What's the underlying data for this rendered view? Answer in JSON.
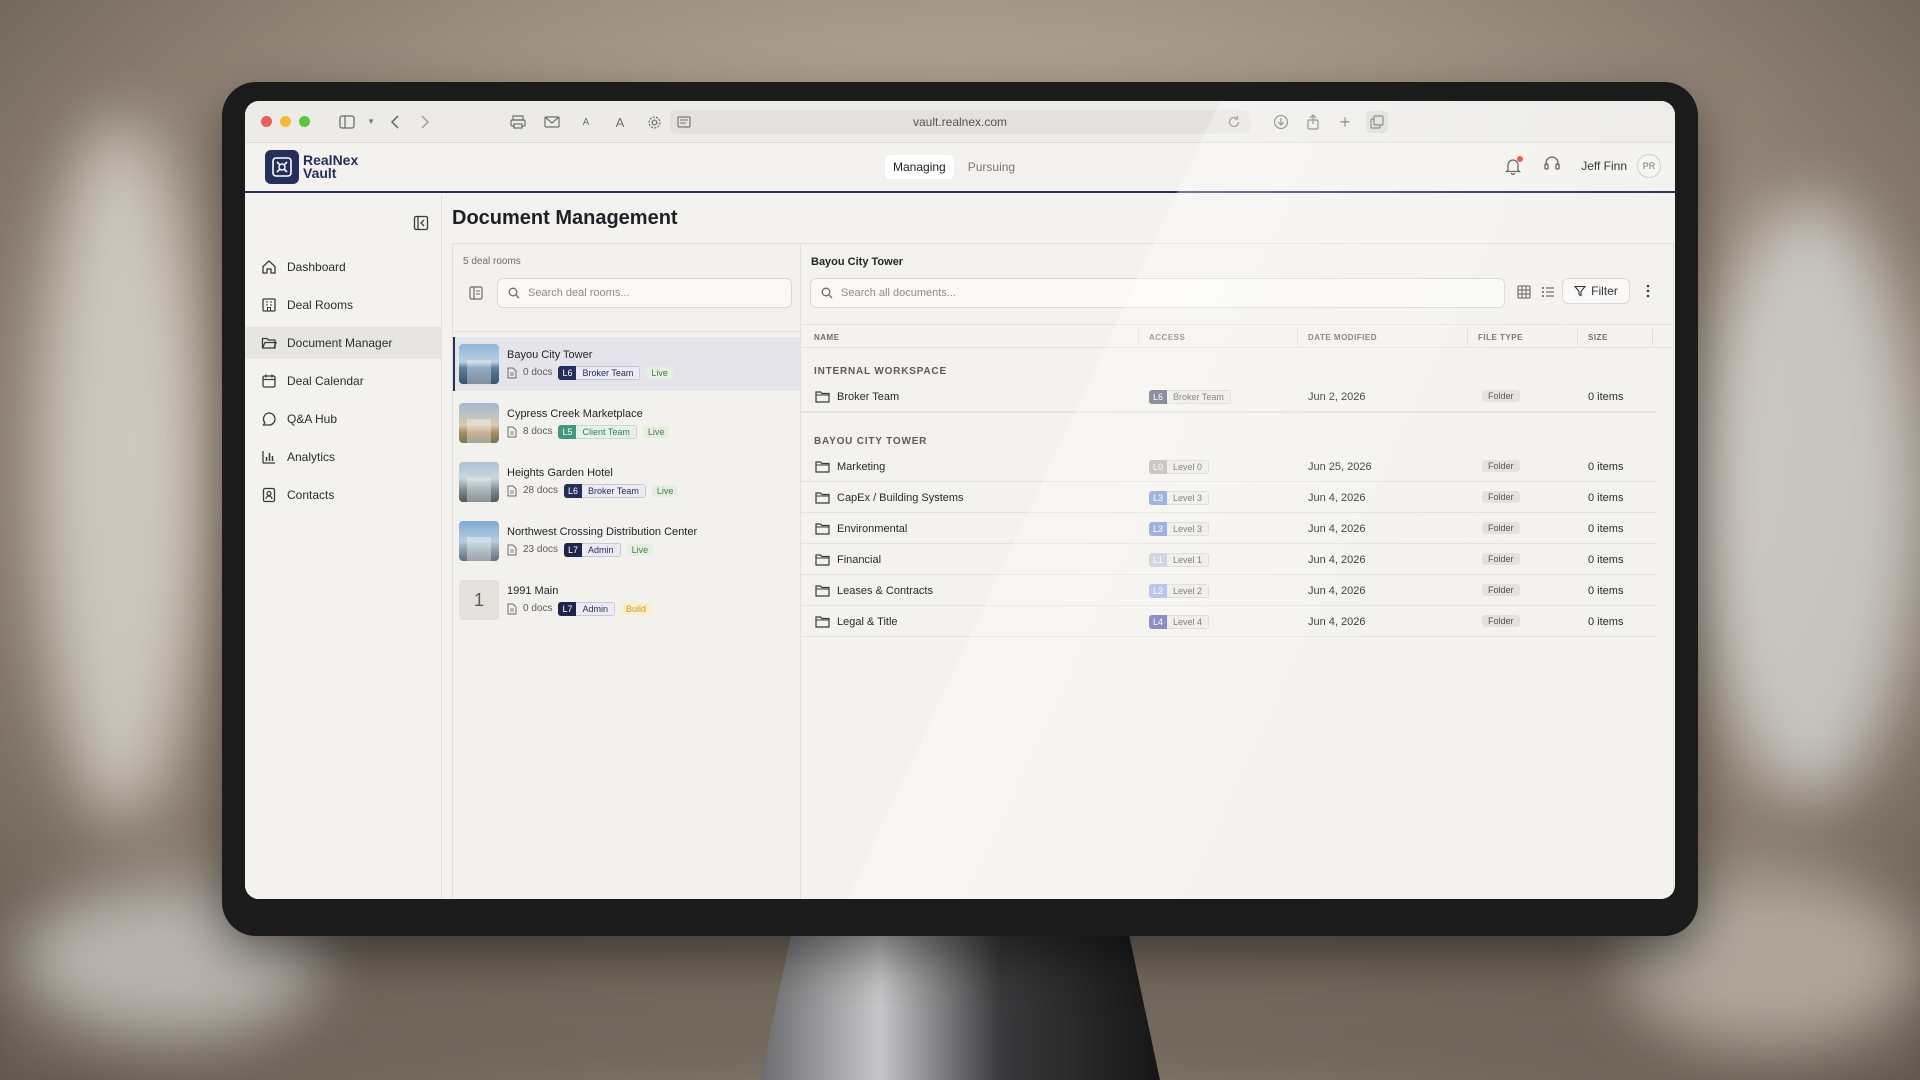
{
  "browser": {
    "url": "vault.realnex.com"
  },
  "app": {
    "logo_line1": "RealNex",
    "logo_line2": "Vault",
    "nav_tabs": [
      {
        "label": "Managing",
        "active": true
      },
      {
        "label": "Pursuing",
        "active": false
      }
    ],
    "user_name": "Jeff Finn",
    "avatar_initials": "PR",
    "brand_color": "#24305a"
  },
  "sidebar": {
    "items": [
      {
        "label": "Dashboard",
        "icon": "home-icon"
      },
      {
        "label": "Deal Rooms",
        "icon": "building-icon"
      },
      {
        "label": "Document Manager",
        "icon": "folder-open-icon",
        "active": true
      },
      {
        "label": "Deal Calendar",
        "icon": "calendar-icon"
      },
      {
        "label": "Q&A Hub",
        "icon": "chat-bubble-icon"
      },
      {
        "label": "Analytics",
        "icon": "bar-chart-icon"
      },
      {
        "label": "Contacts",
        "icon": "contact-card-icon"
      }
    ]
  },
  "page": {
    "title": "Document Management"
  },
  "deal_rooms": {
    "count_label": "5 deal rooms",
    "search_placeholder": "Search deal rooms...",
    "rooms": [
      {
        "name": "Bayou City Tower",
        "docs": "0 docs",
        "level": "L6",
        "team": "Broker Team",
        "status": "Live",
        "level_color": "#24305a",
        "active": true
      },
      {
        "name": "Cypress Creek Marketplace",
        "docs": "8 docs",
        "level": "L5",
        "team": "Client Team",
        "status": "Live",
        "level_color": "#3f9b7d"
      },
      {
        "name": "Heights Garden Hotel",
        "docs": "28 docs",
        "level": "L6",
        "team": "Broker Team",
        "status": "Live",
        "level_color": "#24305a"
      },
      {
        "name": "Northwest Crossing Distribution Center",
        "docs": "23 docs",
        "level": "L7",
        "team": "Admin",
        "status": "Live",
        "level_color": "#1f2547"
      },
      {
        "name": "1991 Main",
        "docs": "0 docs",
        "level": "L7",
        "team": "Admin",
        "status": "Build",
        "level_color": "#1f2547",
        "placeholder": "1"
      }
    ]
  },
  "documents": {
    "room_title": "Bayou City Tower",
    "search_placeholder": "Search all documents...",
    "filter_label": "Filter",
    "columns": [
      "NAME",
      "ACCESS",
      "DATE MODIFIED",
      "FILE TYPE",
      "SIZE"
    ],
    "sections": [
      {
        "label": "INTERNAL WORKSPACE",
        "rows": [
          {
            "name": "Broker Team",
            "level": "L6",
            "access": "Broker Team",
            "date": "Jun 2, 2026",
            "type": "Folder",
            "size": "0 items",
            "level_color": "#5b5f74"
          }
        ]
      },
      {
        "label": "BAYOU CITY TOWER",
        "rows": [
          {
            "name": "Marketing",
            "level": "L0",
            "access": "Level 0",
            "date": "Jun 25, 2026",
            "type": "Folder",
            "size": "0 items",
            "level_color": "#b6b3ae"
          },
          {
            "name": "CapEx / Building Systems",
            "level": "L3",
            "access": "Level 3",
            "date": "Jun 4, 2026",
            "type": "Folder",
            "size": "0 items",
            "level_color": "#7f97d4"
          },
          {
            "name": "Environmental",
            "level": "L3",
            "access": "Level 3",
            "date": "Jun 4, 2026",
            "type": "Folder",
            "size": "0 items",
            "level_color": "#7f97d4"
          },
          {
            "name": "Financial",
            "level": "L1",
            "access": "Level 1",
            "date": "Jun 4, 2026",
            "type": "Folder",
            "size": "0 items",
            "level_color": "#c3c7d8"
          },
          {
            "name": "Leases & Contracts",
            "level": "L2",
            "access": "Level 2",
            "date": "Jun 4, 2026",
            "type": "Folder",
            "size": "0 items",
            "level_color": "#a5b6e4"
          },
          {
            "name": "Legal & Title",
            "level": "L4",
            "access": "Level 4",
            "date": "Jun 4, 2026",
            "type": "Folder",
            "size": "0 items",
            "level_color": "#6f6fb8"
          }
        ]
      }
    ]
  }
}
